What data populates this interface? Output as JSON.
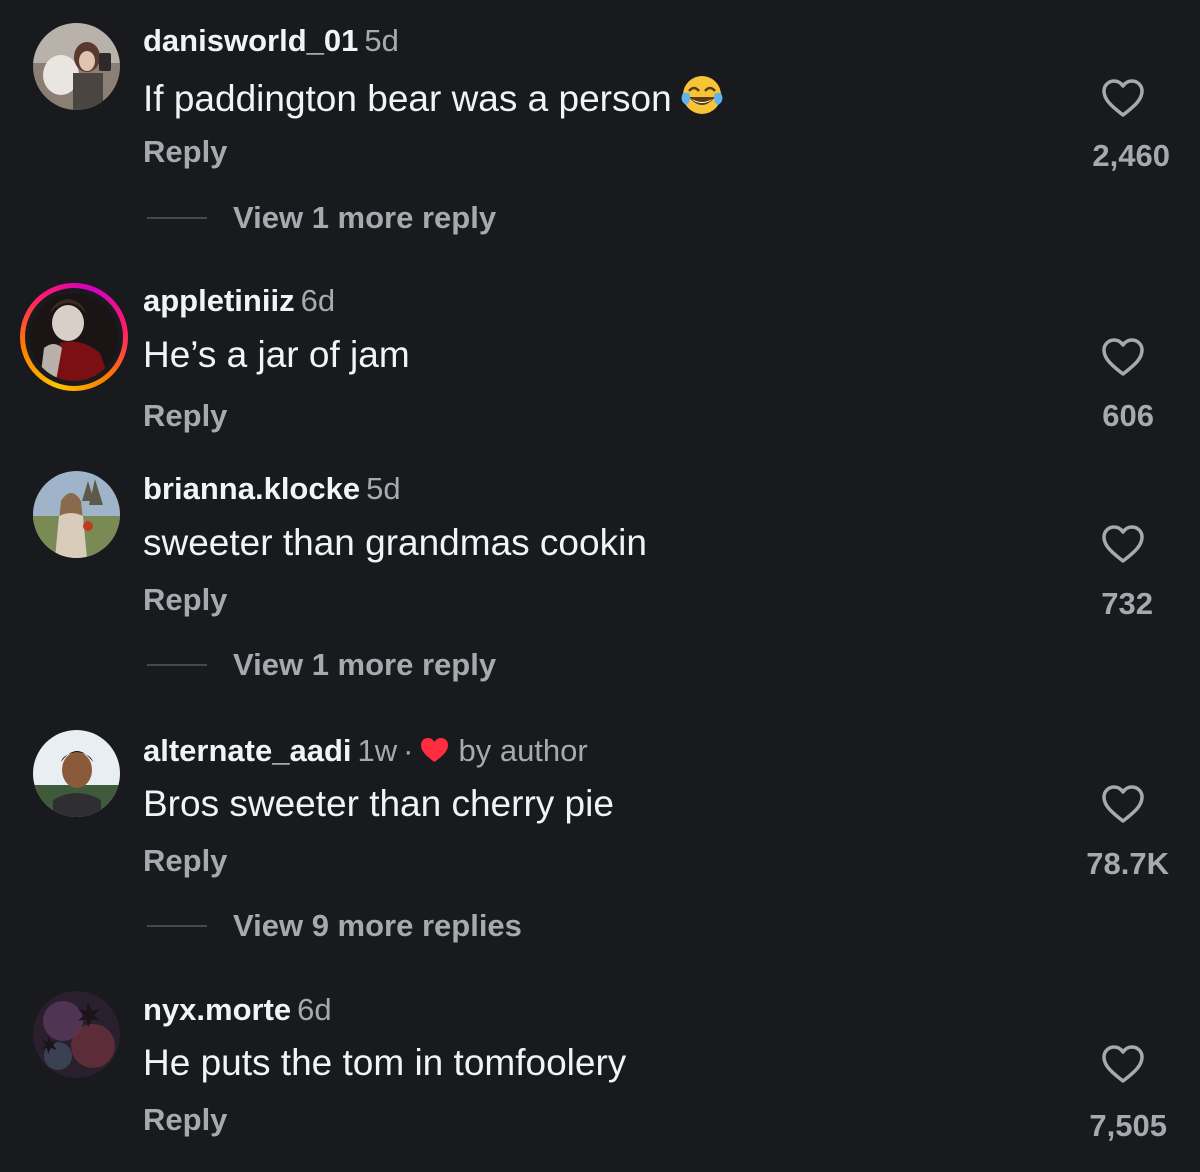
{
  "comments": [
    {
      "username": "danisworld_01",
      "time": "5d",
      "text": "If paddington bear was a person",
      "emoji": "face-with-tears-of-joy",
      "reply_label": "Reply",
      "likes": "2,460",
      "view_more": "View 1 more reply"
    },
    {
      "username": "appletiniiz",
      "time": "6d",
      "text": "He’s a jar of jam",
      "reply_label": "Reply",
      "likes": "606"
    },
    {
      "username": "brianna.klocke",
      "time": "5d",
      "text": "sweeter than grandmas cookin",
      "reply_label": "Reply",
      "likes": "732",
      "view_more": "View 1 more reply"
    },
    {
      "username": "alternate_aadi",
      "time": "1w",
      "separator": "·",
      "author_badge": "by author",
      "author_heart_color": "#ff2d3f",
      "text": "Bros sweeter than cherry pie",
      "reply_label": "Reply",
      "likes": "78.7K",
      "view_more": "View 9 more replies"
    },
    {
      "username": "nyx.morte",
      "time": "6d",
      "text": "He puts the tom in tomfoolery",
      "reply_label": "Reply",
      "likes": "7,505"
    }
  ],
  "icons": {
    "like": "heart-outline-icon",
    "author_like": "heart-filled-icon"
  },
  "colors": {
    "background": "#181a1d",
    "primary_text": "#f2f3f5",
    "secondary_text": "#a6a9ae"
  }
}
